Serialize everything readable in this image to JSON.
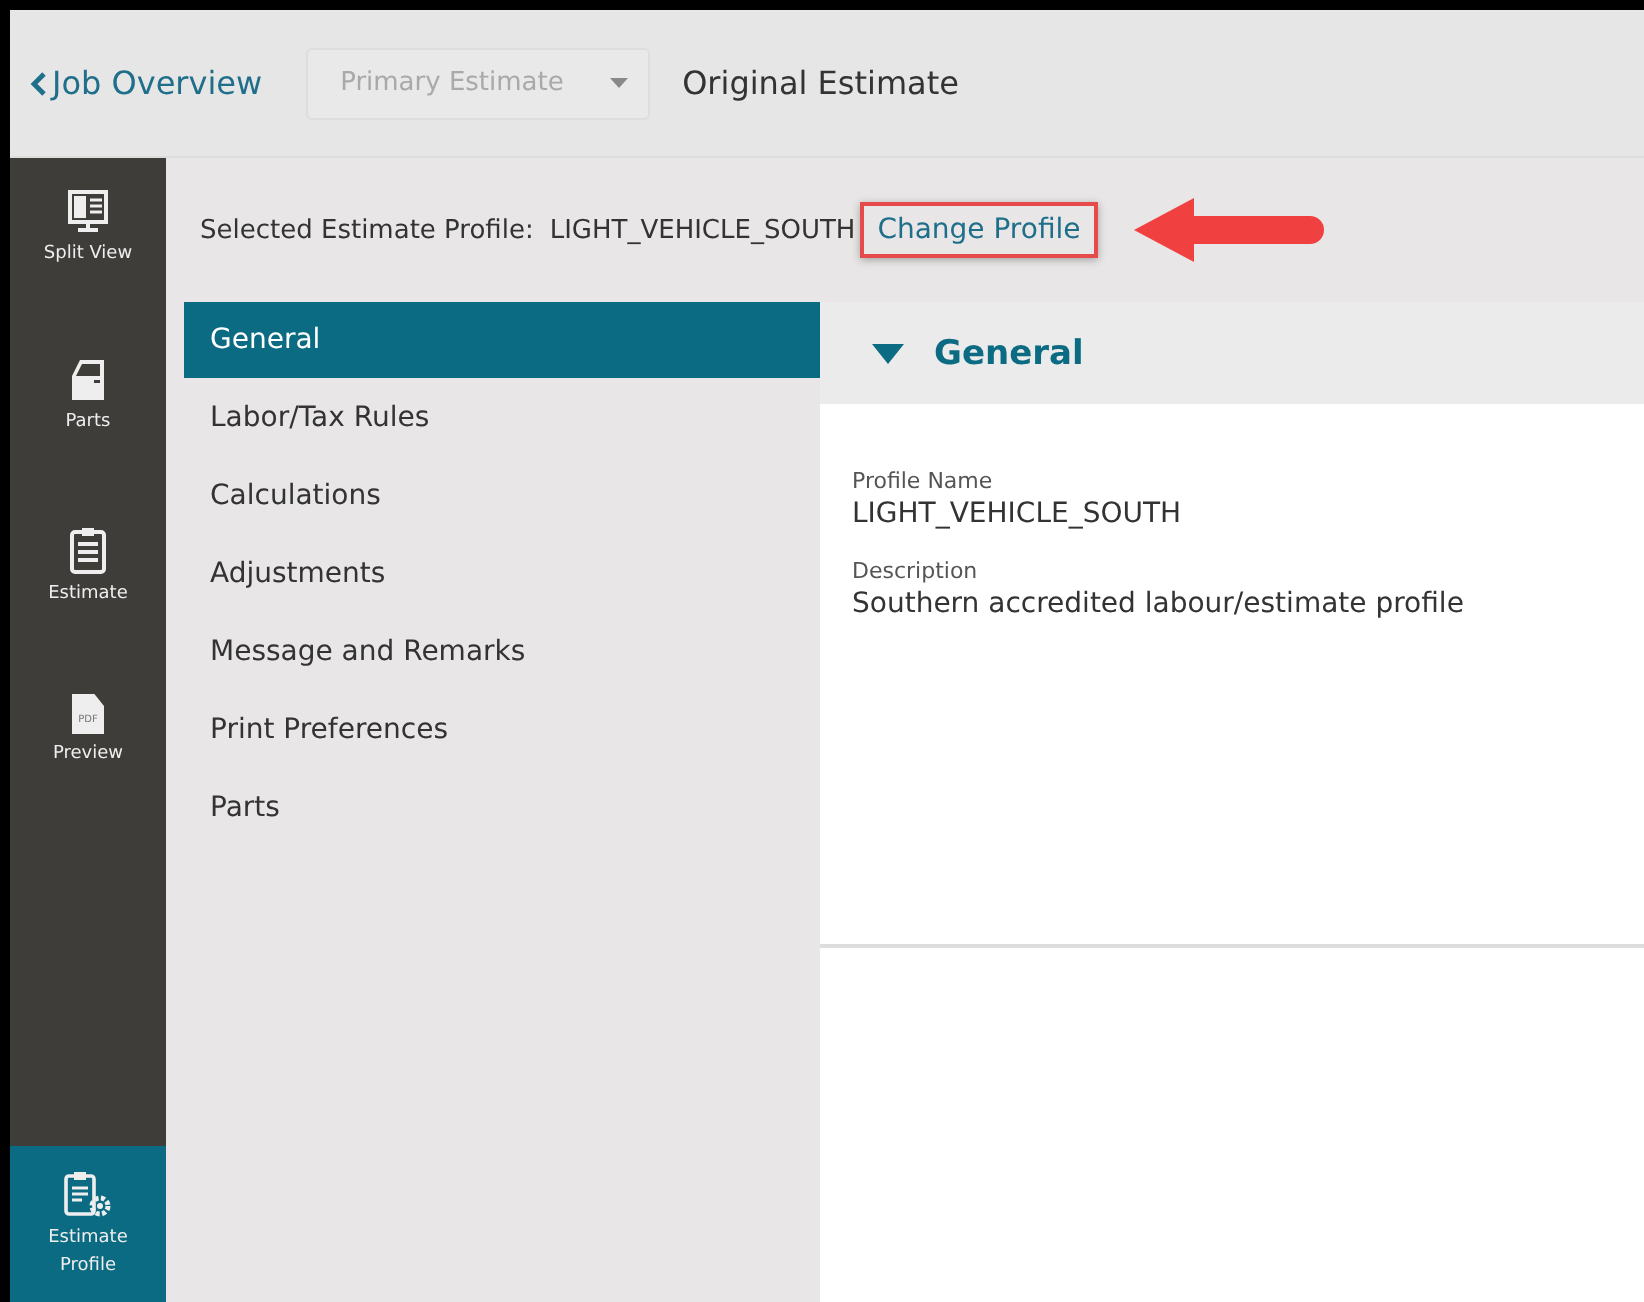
{
  "top_bar": {
    "back_link": "Job Overview",
    "estimate_dropdown": {
      "value": "Primary Estimate",
      "disabled": true
    },
    "title": "Original Estimate"
  },
  "sidebar": {
    "items": [
      {
        "kind": "split",
        "label": "Split View",
        "selected": false
      },
      {
        "kind": "door",
        "label": "Parts",
        "selected": false
      },
      {
        "kind": "clipboard",
        "label": "Estimate",
        "selected": false
      },
      {
        "kind": "pdf",
        "label": "Preview",
        "selected": false,
        "badge": "PDF"
      },
      {
        "kind": "profile",
        "label": "Estimate Profile",
        "selected": true
      }
    ]
  },
  "profile_bar": {
    "label": "Selected Estimate Profile:",
    "value": "LIGHT_VEHICLE_SOUTH",
    "link": "Change Profile",
    "highlighted": true
  },
  "nav": {
    "items": [
      {
        "label": "General",
        "selected": true
      },
      {
        "label": "Labor/Tax Rules",
        "selected": false
      },
      {
        "label": "Calculations",
        "selected": false
      },
      {
        "label": "Adjustments",
        "selected": false
      },
      {
        "label": "Message and Remarks",
        "selected": false
      },
      {
        "label": "Print Preferences",
        "selected": false
      },
      {
        "label": "Parts",
        "selected": false
      }
    ]
  },
  "section": {
    "title": "General",
    "expanded": true,
    "fields": [
      {
        "label": "Profile Name",
        "value": "LIGHT_VEHICLE_SOUTH"
      },
      {
        "label": "Description",
        "value": "Southern accredited labour/estimate profile"
      }
    ]
  }
}
